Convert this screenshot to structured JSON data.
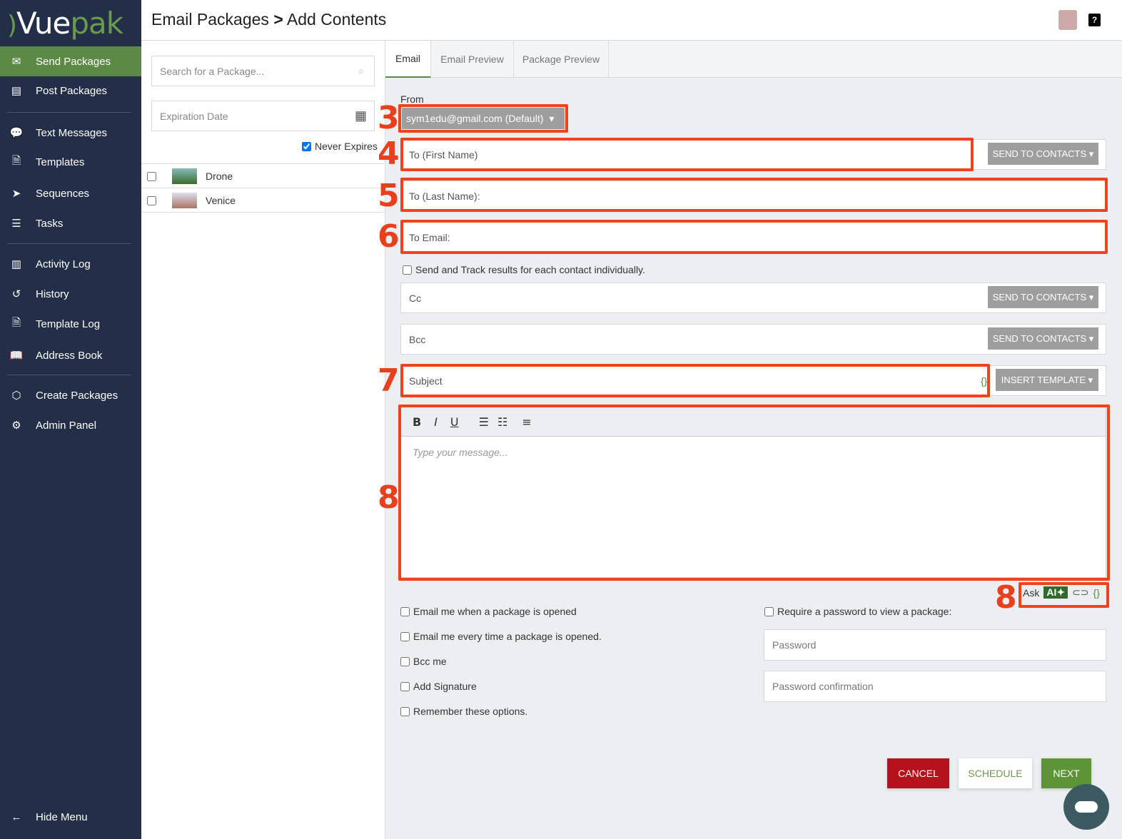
{
  "logo": {
    "part1": "Vue",
    "part2": "pak"
  },
  "sidebar": {
    "items": [
      {
        "label": "Send Packages",
        "icon": "envelope-icon"
      },
      {
        "label": "Post Packages",
        "icon": "monitor-icon"
      },
      {
        "label": "Text Messages",
        "icon": "chat-icon"
      },
      {
        "label": "Templates",
        "icon": "document-icon"
      },
      {
        "label": "Sequences",
        "icon": "send-icon"
      },
      {
        "label": "Tasks",
        "icon": "tasks-icon"
      },
      {
        "label": "Activity Log",
        "icon": "chart-icon"
      },
      {
        "label": "History",
        "icon": "history-icon"
      },
      {
        "label": "Template Log",
        "icon": "document-icon"
      },
      {
        "label": "Address Book",
        "icon": "book-icon"
      },
      {
        "label": "Create Packages",
        "icon": "cubes-icon"
      },
      {
        "label": "Admin Panel",
        "icon": "admin-icon"
      }
    ],
    "hide_menu": "Hide Menu"
  },
  "header": {
    "title": "Email Packages",
    "sep": ">",
    "subtitle": "Add Contents",
    "help": "?"
  },
  "packages": {
    "search_placeholder": "Search for a Package...",
    "expiration_placeholder": "Expiration Date",
    "never_expires": "Never Expires",
    "items": [
      {
        "name": "Drone"
      },
      {
        "name": "Venice"
      }
    ]
  },
  "tabs": [
    "Email",
    "Email Preview",
    "Package Preview"
  ],
  "form": {
    "from_label": "From",
    "from_value": "sym1edu@gmail.com (Default)",
    "to_first": "To (First Name)",
    "to_last": "To (Last Name):",
    "to_email": "To Email:",
    "send_contacts": "SEND TO CONTACTS",
    "track_individually": "Send and Track results for each contact individually.",
    "cc": "Cc",
    "bcc": "Bcc",
    "subject": "Subject",
    "insert_template": "INSERT TEMPLATE",
    "braces": "{}",
    "message_placeholder": "Type your message...",
    "ask": "Ask",
    "ai": "AI",
    "options": [
      "Email me when a package is opened",
      "Email me every time a package is opened.",
      "Bcc me",
      "Add Signature",
      "Remember these options."
    ],
    "require_password": "Require a password to view a package:",
    "password": "Password",
    "password_confirm": "Password confirmation"
  },
  "buttons": {
    "cancel": "CANCEL",
    "schedule": "SCHEDULE",
    "next": "NEXT"
  },
  "annotations": [
    "3",
    "4",
    "5",
    "6",
    "7",
    "8",
    "8"
  ],
  "colors": {
    "sidebar": "#232e48",
    "accent": "#5a8a45",
    "annotation": "#f0431c",
    "cancel": "#b5121b"
  }
}
